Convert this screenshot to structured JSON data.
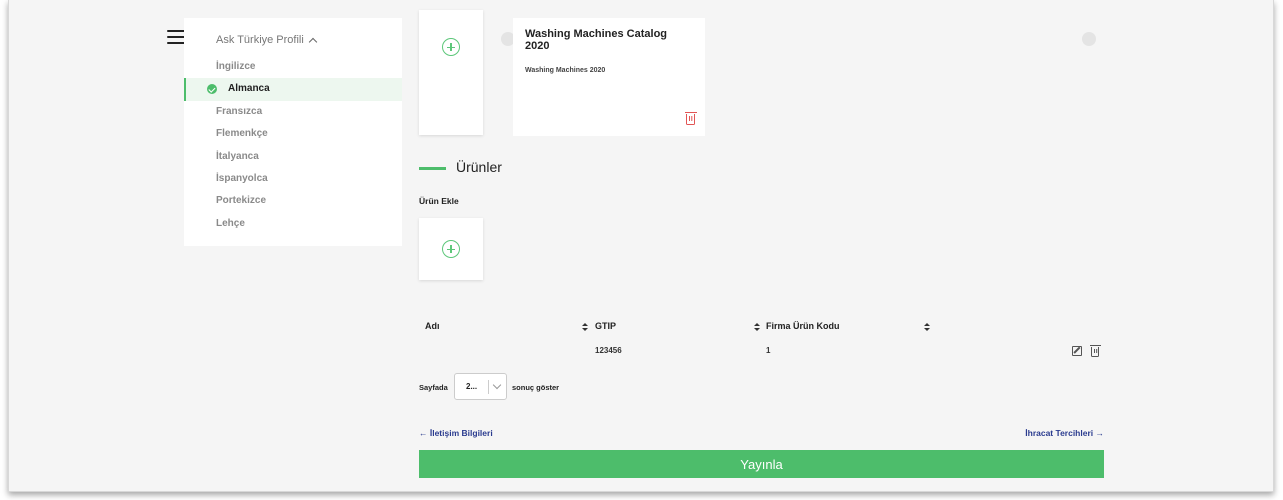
{
  "sidebar": {
    "title": "Ask Türkiye Profili",
    "items": [
      {
        "label": "İngilizce"
      },
      {
        "label": "Almanca"
      },
      {
        "label": "Fransızca"
      },
      {
        "label": "Flemenkçe"
      },
      {
        "label": "İtalyanca"
      },
      {
        "label": "İspanyolca"
      },
      {
        "label": "Portekizce"
      },
      {
        "label": "Lehçe"
      }
    ],
    "active_item": "Almanca"
  },
  "catalog": {
    "title": "Washing Machines Catalog 2020",
    "subtitle": "Washing Machines 2020"
  },
  "products": {
    "section_title": "Ürünler",
    "add_label": "Ürün Ekle",
    "table": {
      "columns": [
        "Adı",
        "GTIP",
        "Firma Ürün Kodu"
      ],
      "rows": [
        {
          "name": "",
          "gtip": "123456",
          "code": "1"
        }
      ]
    },
    "pager": {
      "prefix": "Sayfada",
      "value": "2...",
      "suffix": "sonuç göster"
    }
  },
  "nav": {
    "prev": "← İletişim Bilgileri",
    "next": "İhracat Tercihleri →"
  },
  "publish_label": "Yayınla",
  "colors": {
    "accent": "#4dbd6b",
    "link": "#2a3b8f",
    "danger": "#e25555"
  }
}
